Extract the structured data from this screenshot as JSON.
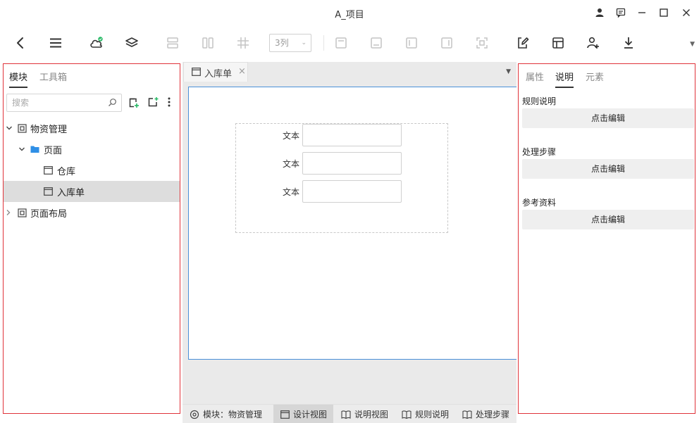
{
  "window": {
    "title": "A_项目"
  },
  "toolbar": {
    "column_select": "3列"
  },
  "left_panel": {
    "tabs": [
      "模块",
      "工具箱"
    ],
    "search_placeholder": "搜索",
    "tree": [
      {
        "label": "物资管理"
      },
      {
        "label": "页面"
      },
      {
        "label": "仓库"
      },
      {
        "label": "入库单"
      },
      {
        "label": "页面布局"
      }
    ]
  },
  "center": {
    "doc_tab": {
      "label": "入库单",
      "close": "×"
    },
    "form_fields": [
      {
        "label": "文本",
        "value": ""
      },
      {
        "label": "文本",
        "value": ""
      },
      {
        "label": "文本",
        "value": ""
      }
    ],
    "bottom_bar": {
      "module_label": "模块：物资管理",
      "views": [
        "设计视图",
        "说明视图",
        "规则说明",
        "处理步骤"
      ]
    }
  },
  "right_panel": {
    "tabs": [
      "属性",
      "说明",
      "元素"
    ],
    "sections": [
      {
        "title": "规则说明",
        "button": "点击编辑"
      },
      {
        "title": "处理步骤",
        "button": "点击编辑"
      },
      {
        "title": "参考资料",
        "button": "点击编辑"
      }
    ]
  },
  "colors": {
    "panel_border": "#e0333a",
    "canvas_border": "#4a90d9",
    "folder_icon": "#2f8fe6",
    "cloud_badge": "#25b864"
  },
  "icons": {
    "titlebar": [
      "user-icon",
      "message-icon",
      "minimize-icon",
      "maximize-icon",
      "close-icon"
    ],
    "toolbar": [
      "back-icon",
      "menu-icon",
      "cloud-sync-icon",
      "layers-icon",
      "rows-icon",
      "columns-icon",
      "grid-icon",
      "align-top-icon",
      "align-bottom-icon",
      "align-left-icon",
      "align-right-icon",
      "fit-icon",
      "edit-page-icon",
      "layout-icon",
      "add-user-icon",
      "download-icon"
    ]
  }
}
